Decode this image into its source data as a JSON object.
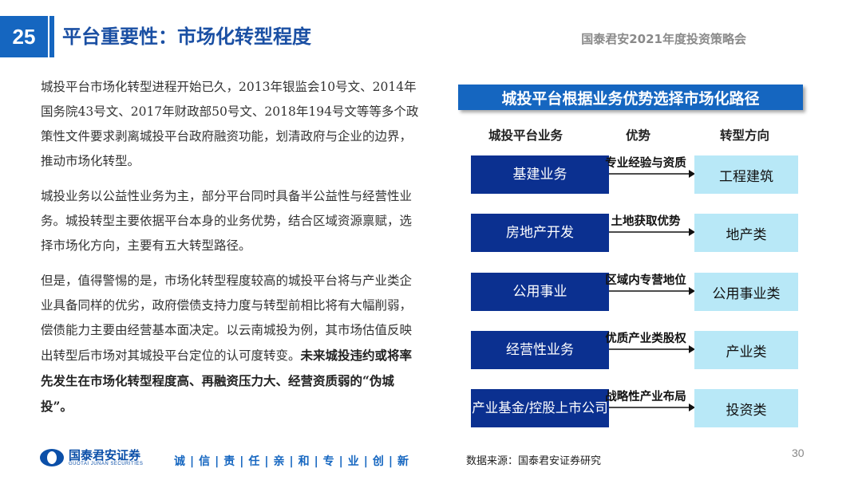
{
  "header": {
    "page_number": "25",
    "title": "平台重要性：市场化转型程度",
    "report_name": "国泰君安2021年度投资策略会"
  },
  "body": {
    "p1": "城投平台市场化转型进程开始已久，2013年银监会10号文、2014年国务院43号文、2017年财政部50号文、2018年194号文等等多个政策性文件要求剥离城投平台政府融资功能，划清政府与企业的边界，推动市场化转型。",
    "p2": "城投业务以公益性业务为主，部分平台同时具备半公益性与经营性业务。城投转型主要依据平台本身的业务优势，结合区域资源禀赋，选择市场化方向，主要有五大转型路径。",
    "p3_normal": "但是，值得警惕的是，市场化转型程度较高的城投平台将与产业类企业具备同样的优劣，政府偿债支持力度与转型前相比将有大幅削弱，偿债能力主要由经营基本面决定。以云南城投为例，其市场估值反映出转型后市场对其城投平台定位的认可度转变。",
    "p3_bold": "未来城投违约或将率先发生在市场化转型程度高、再融资压力大、经营资质弱的“伪城投”。"
  },
  "diagram": {
    "title": "城投平台根据业务优势选择市场化路径",
    "col_business": "城投平台业务",
    "col_advantage": "优势",
    "col_direction": "转型方向",
    "rows": [
      {
        "business": "基建业务",
        "advantage": "专业经验与资质",
        "direction": "工程建筑"
      },
      {
        "business": "房地产开发",
        "advantage": "土地获取优势",
        "direction": "地产类"
      },
      {
        "business": "公用事业",
        "advantage": "区域内专营地位",
        "direction": "公用事业类"
      },
      {
        "business": "经营性业务",
        "advantage": "优质产业类股权",
        "direction": "产业类"
      },
      {
        "business": "产业基金/控股上市公司",
        "advantage": "战略性产业布局",
        "direction": "投资类"
      }
    ],
    "colors": {
      "business_box": "#0b3090",
      "direction_box": "#b8e8f7",
      "title_bar": "#1566c0"
    }
  },
  "footer": {
    "logo_name": "国泰君安证券",
    "logo_sub": "GUOTAI JUNAN SECURITIES",
    "slogan": "诚|信|责|任|亲|和|专|业|创|新",
    "source": "数据来源：国泰君安证券研究",
    "slide_number": "30"
  }
}
